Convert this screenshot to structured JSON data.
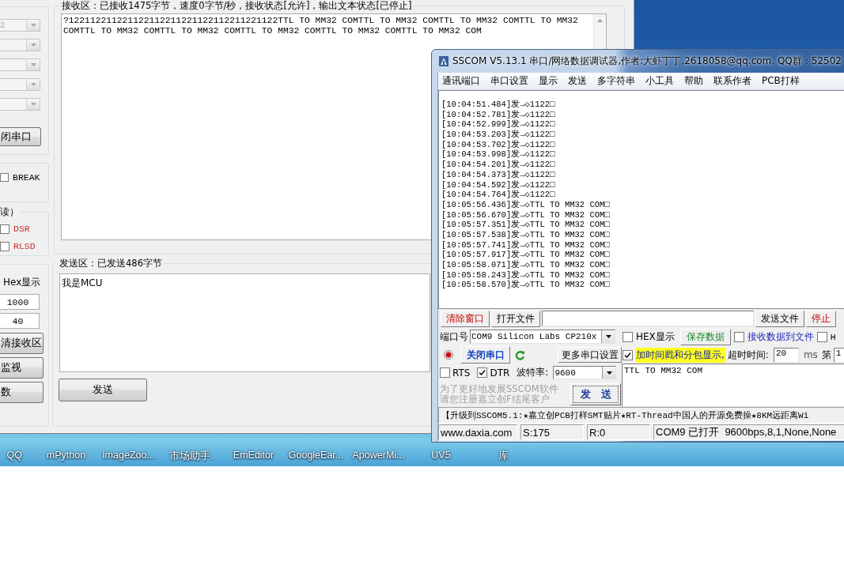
{
  "serial_window": {
    "port_combos": [
      {
        "value": "2",
        "disabled": true
      },
      {
        "disabled": true
      },
      {
        "disabled": true
      },
      {
        "disabled": true
      },
      {
        "disabled": true
      }
    ],
    "close_port_button": "闭串口",
    "break_option": {
      "label": "BREAK",
      "checked": false
    },
    "line_status": {
      "legend": "读）",
      "items": [
        {
          "label": "DSR",
          "checked": false
        },
        {
          "label": "RLSD",
          "checked": false
        }
      ]
    },
    "display_options": {
      "hex_label": "Hex显示",
      "fields": [
        "1000",
        "40"
      ],
      "buttons": [
        "清接收区",
        "监视",
        "数"
      ]
    },
    "receive": {
      "legend": "接收区：已接收1475字节，速度0字节/秒，接收状态[允许]，输出文本状态[已停止]",
      "lines": [
        "?122112211221122112211221122112211221122TTL TO MM32 COMTTL TO MM32 COMTTL TO MM32 COMTTL TO MM32",
        "COMTTL TO MM32 COMTTL TO MM32 COMTTL TO MM32 COMTTL TO MM32 COMTTL TO MM32 COM"
      ]
    },
    "send": {
      "legend": "发送区：已发送486字节",
      "text": "我是MCU",
      "button": "发送"
    }
  },
  "sscom_window": {
    "title": "SSCOM V5.13.1 串口/网络数据调试器,作者:大虾丁丁,2618058@qq.com. QQ群：52502",
    "menu": [
      "通讯端口",
      "串口设置",
      "显示",
      "发送",
      "多字符串",
      "小工具",
      "帮助",
      "联系作者",
      "PCB打样"
    ],
    "log": [
      "[10:04:51.484]发→◇1122□",
      "[10:04:52.781]发→◇1122□",
      "[10:04:52.999]发→◇1122□",
      "[10:04:53.203]发→◇1122□",
      "[10:04:53.702]发→◇1122□",
      "[10:04:53.998]发→◇1122□",
      "[10:04:54.201]发→◇1122□",
      "[10:04:54.373]发→◇1122□",
      "[10:04:54.592]发→◇1122□",
      "[10:04:54.764]发→◇1122□",
      "[10:05:56.436]发→◇TTL TO MM32 COM□",
      "[10:05:56.670]发→◇TTL TO MM32 COM□",
      "[10:05:57.351]发→◇TTL TO MM32 COM□",
      "[10:05:57.538]发→◇TTL TO MM32 COM□",
      "[10:05:57.741]发→◇TTL TO MM32 COM□",
      "[10:05:57.917]发→◇TTL TO MM32 COM□",
      "[10:05:58.071]发→◇TTL TO MM32 COM□",
      "[10:05:58.243]发→◇TTL TO MM32 COM□",
      "[10:05:58.570]发→◇TTL TO MM32 COM□"
    ],
    "toolbar": [
      {
        "kind": "button",
        "label": "清除窗口",
        "alert": true
      },
      {
        "kind": "button",
        "label": "打开文件",
        "alert": false
      },
      {
        "kind": "field"
      },
      {
        "kind": "button",
        "label": "发送文件",
        "alert": false
      },
      {
        "kind": "button",
        "label": "停止",
        "alert": true
      }
    ],
    "port": {
      "label": "端口号",
      "value": "COM9 Silicon Labs CP210x"
    },
    "port_indicator": {
      "on": true
    },
    "open_button": "关闭串口",
    "more_settings_button": "更多串口设置",
    "flow_control": [
      {
        "label": "RTS",
        "checked": false
      },
      {
        "label": "DTR",
        "checked": true
      }
    ],
    "baud_rate": {
      "label": "波特率:",
      "value": "9600"
    },
    "promo": [
      "为了更好地发展SSCOM软件",
      "请您注册嘉立创F结尾客户"
    ],
    "send_button": "发　送",
    "hex_display": {
      "label": "HEX显示",
      "checked": false
    },
    "save_button": "保存数据",
    "save_to_file": {
      "label": "接收数据到文件",
      "checked": false
    },
    "option_4": {
      "label": "H",
      "checked": false
    },
    "timestamp": {
      "label": "加时间戳和分包显示,",
      "checked": true
    },
    "timeout": {
      "label": "超时时间:",
      "value": "20",
      "unit": "ms"
    },
    "packet": {
      "label": "第",
      "value": "1"
    },
    "send_text": "TTL TO MM32 COM",
    "ticker": "【升级到SSCOM5.1:★嘉立创PCB打样SMT贴片★RT-Thread中国人的开源免费操★8KM远距离Wi",
    "status_bar": [
      "www.daxia.com",
      "S:175",
      "R:0",
      "COM9 已打开  9600bps,8,1,None,None"
    ]
  },
  "desktop": {
    "icon_labels": [
      "QQ",
      "mPython",
      "ImageZoo...",
      "市场助手.",
      "EmEditor",
      "GoogleEar...",
      "ApowerMi...",
      "UV5",
      "库"
    ]
  }
}
